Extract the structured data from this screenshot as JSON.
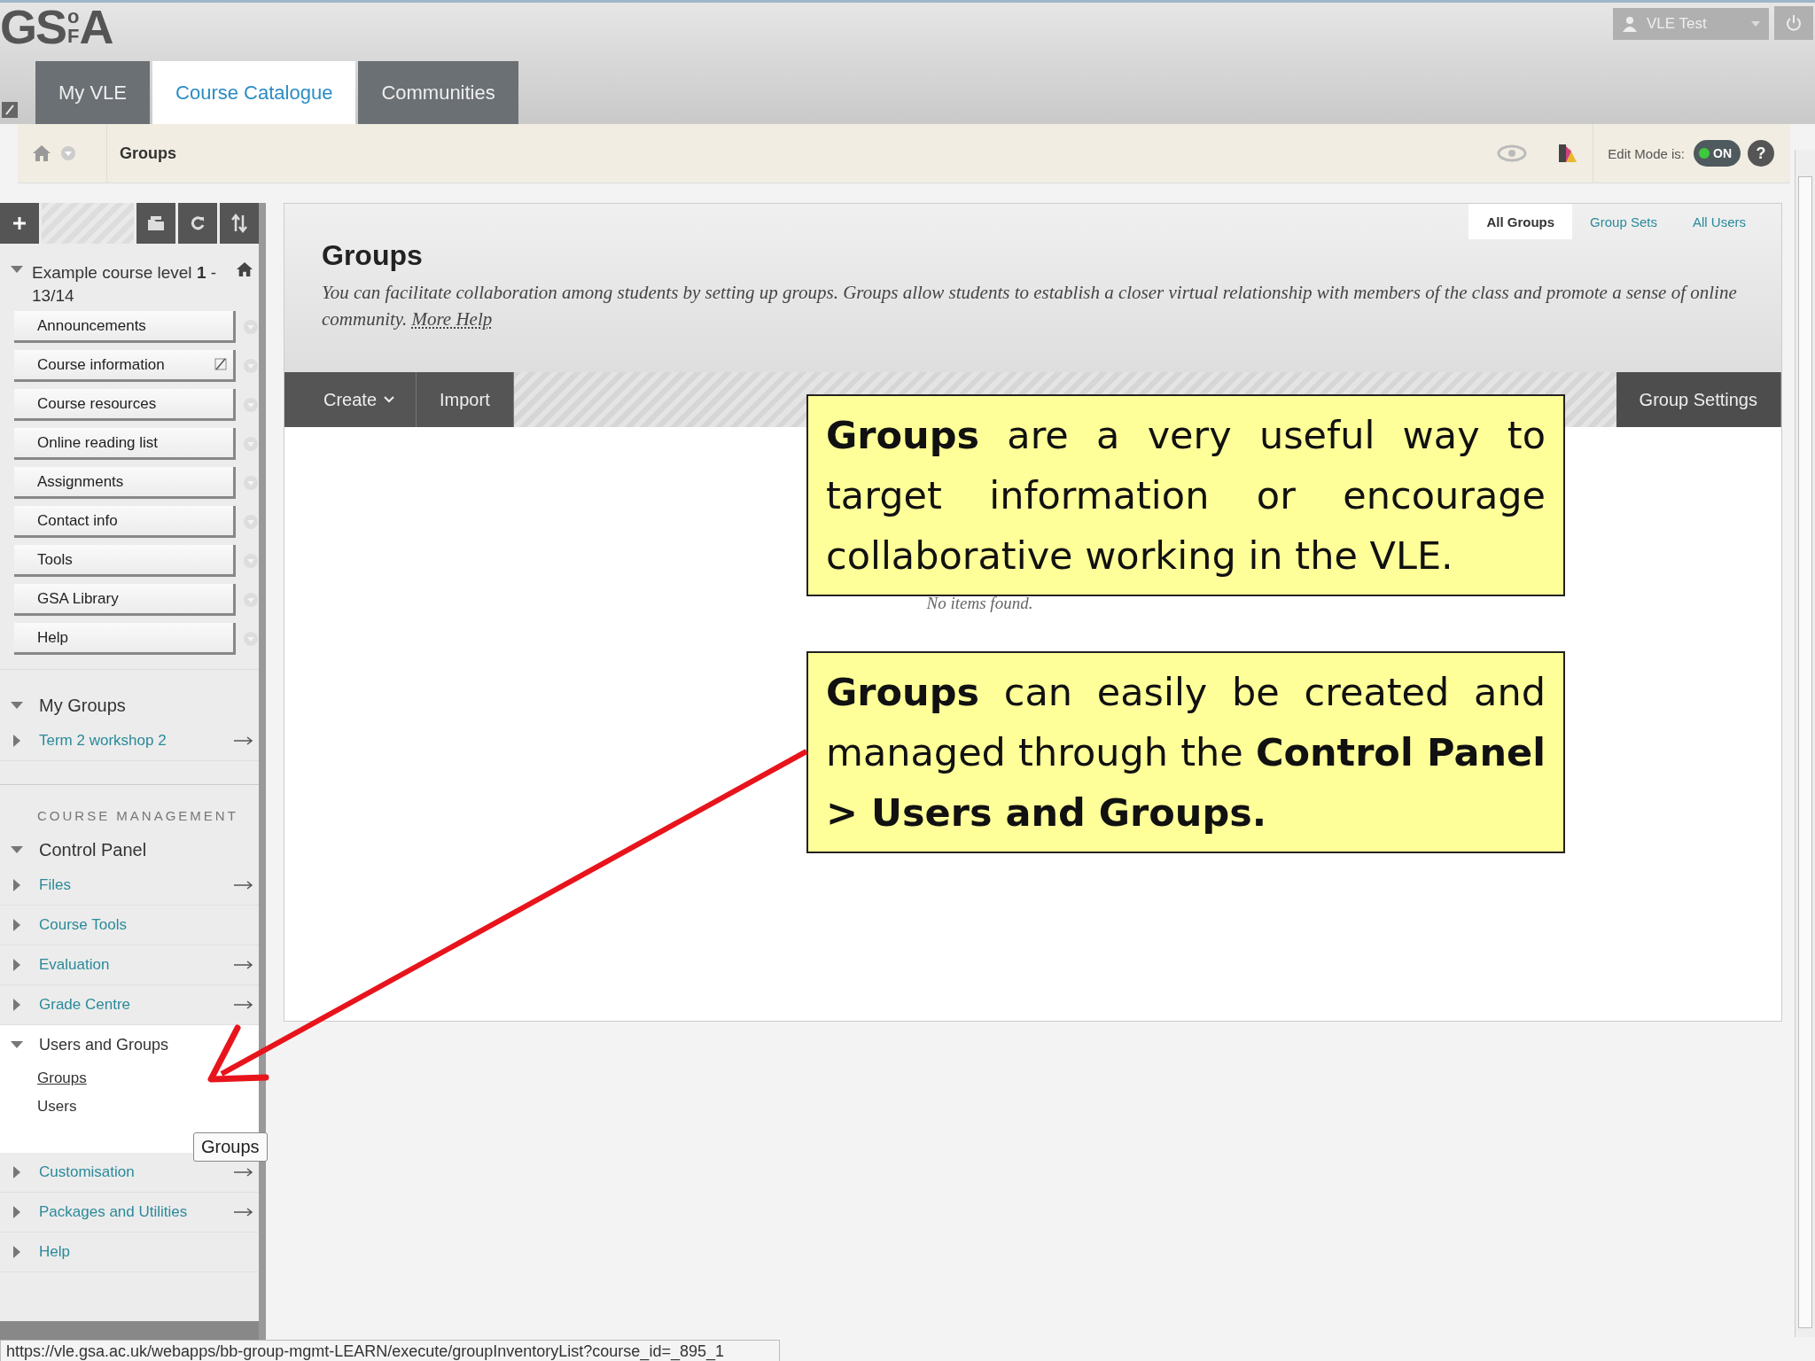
{
  "header": {
    "logo": {
      "main": "GS",
      "top": "o",
      "bottom": "F",
      "end": "A"
    },
    "user": "VLE Test"
  },
  "tabs": [
    {
      "label": "My VLE",
      "selected": false
    },
    {
      "label": "Course Catalogue",
      "selected": true
    },
    {
      "label": "Communities",
      "selected": false
    }
  ],
  "breadcrumb": {
    "current": "Groups",
    "edit_mode_label": "Edit Mode is:",
    "edit_mode": {
      "on": true,
      "label": "ON"
    },
    "help": "?"
  },
  "sidebar": {
    "course_title": "Example course level **1** - 13/14",
    "course_menu": [
      {
        "label": "Announcements",
        "hidden": false
      },
      {
        "label": "Course information",
        "hidden": true
      },
      {
        "label": "Course resources",
        "hidden": false
      },
      {
        "label": "Online reading list",
        "hidden": false
      },
      {
        "label": "Assignments",
        "hidden": false
      },
      {
        "label": "Contact info",
        "hidden": false
      },
      {
        "label": "Tools",
        "hidden": false
      },
      {
        "label": "GSA Library",
        "hidden": false
      },
      {
        "label": "Help",
        "hidden": false
      }
    ],
    "my_groups": {
      "title": "My Groups",
      "expanded": true,
      "items": [
        {
          "label": "Term 2 workshop 2",
          "expanded": false,
          "link_arrow": true
        }
      ]
    },
    "management_heading": "COURSE MANAGEMENT",
    "control_panel": {
      "title": "Control Panel",
      "expanded": true,
      "items": [
        {
          "label": "Files",
          "expanded": false,
          "link_arrow": true
        },
        {
          "label": "Course Tools",
          "expanded": false,
          "link_arrow": false
        },
        {
          "label": "Evaluation",
          "expanded": false,
          "link_arrow": true
        },
        {
          "label": "Grade Centre",
          "expanded": false,
          "link_arrow": true
        },
        {
          "label": "Users and Groups",
          "expanded": true,
          "link_arrow": false,
          "children": [
            {
              "label": "Groups",
              "selected": true
            },
            {
              "label": "Users",
              "selected": false
            }
          ]
        },
        {
          "label": "Customisation",
          "expanded": false,
          "link_arrow": true
        },
        {
          "label": "Packages and Utilities",
          "expanded": false,
          "link_arrow": true
        },
        {
          "label": "Help",
          "expanded": false,
          "link_arrow": false
        }
      ]
    },
    "tooltip": "Groups"
  },
  "content": {
    "sub_tabs": [
      {
        "label": "All Groups",
        "selected": true
      },
      {
        "label": "Group Sets",
        "selected": false
      },
      {
        "label": "All Users",
        "selected": false
      }
    ],
    "title": "Groups",
    "description": "You can facilitate collaboration among students by setting up groups. Groups allow students to establish a closer virtual relationship with members of the class and promote a sense of online community.",
    "help_link": "More Help",
    "toolbar": [
      {
        "label": "Create",
        "kind": "menu"
      },
      {
        "label": "Import",
        "kind": "button"
      }
    ],
    "settings_button": "Group Settings",
    "empty_message": "No items found."
  },
  "callouts": [
    "**Groups** are a very useful way to target information or encourage collaborative working in the VLE.",
    "**Groups** can easily be created and managed through the **Control Panel > Users and Groups.**"
  ],
  "status_bar": "https://vle.gsa.ac.uk/webapps/bb-group-mgmt-LEARN/execute/groupInventoryList?course_id=_895_1"
}
